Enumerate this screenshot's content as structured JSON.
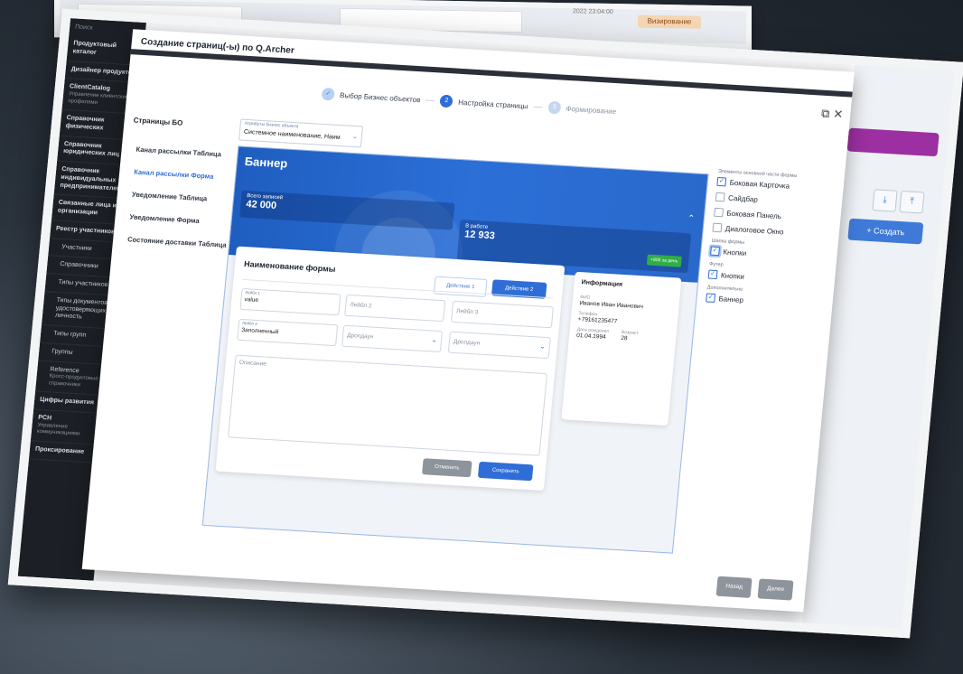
{
  "background": {
    "status_badge": "Визирование",
    "timestamp": "2022 23:04:00"
  },
  "app": {
    "search_placeholder": "Поиск",
    "sidebar": [
      {
        "label": "Продуктовый каталог",
        "sub": false,
        "hint": ""
      },
      {
        "label": "Дизайнер продуктов",
        "sub": false,
        "hint": ""
      },
      {
        "label": "ClientCatalog",
        "sub": false,
        "hint": "Управление клиентскими профилями"
      },
      {
        "label": "Справочник физических",
        "sub": false,
        "hint": ""
      },
      {
        "label": "Справочник юридических лиц",
        "sub": false,
        "hint": ""
      },
      {
        "label": "Справочник индивидуальных предпринимателей",
        "sub": false,
        "hint": ""
      },
      {
        "label": "Связанные лица и организации",
        "sub": false,
        "hint": ""
      },
      {
        "label": "Реестр участников",
        "sub": false,
        "hint": ""
      },
      {
        "label": "Участники",
        "sub": true,
        "hint": ""
      },
      {
        "label": "Справочники",
        "sub": true,
        "hint": ""
      },
      {
        "label": "Типы участников",
        "sub": true,
        "hint": ""
      },
      {
        "label": "Типы документов, удостоверяющих личность",
        "sub": true,
        "hint": ""
      },
      {
        "label": "Типы групп",
        "sub": true,
        "hint": ""
      },
      {
        "label": "Группы",
        "sub": true,
        "hint": ""
      },
      {
        "label": "Reference",
        "sub": true,
        "hint": "Кросс-продуктовые справочники"
      },
      {
        "label": "Цифры развития",
        "sub": false,
        "hint": ""
      },
      {
        "label": "PCH",
        "sub": false,
        "hint": "Управление коммуникациями"
      },
      {
        "label": "Проксирование",
        "sub": false,
        "hint": ""
      }
    ],
    "create_button": "+ Создать"
  },
  "modal": {
    "title": "Создание страниц(-ы) по Q.Archer",
    "steps": [
      {
        "num": "✓",
        "label": "Выбор Бизнес объектов",
        "state": "done"
      },
      {
        "num": "2",
        "label": "Настройка страницы",
        "state": "active"
      },
      {
        "num": "3",
        "label": "Формирование",
        "state": "todo"
      }
    ],
    "pages_title": "Страницы БО",
    "pages": [
      {
        "label": "Канал рассылки Таблица",
        "active": false
      },
      {
        "label": "Канал рассылки Форма",
        "active": true
      },
      {
        "label": "Уведомление Таблица",
        "active": false
      },
      {
        "label": "Уведомление Форма",
        "active": false
      },
      {
        "label": "Состояние доставки Таблица",
        "active": false
      }
    ],
    "attr_select": {
      "label": "Атрибуты бизнес объекта",
      "value": "Системное наименование, Наим"
    },
    "banner": {
      "title": "Баннер",
      "total_label": "Всего записей",
      "total_value": "42 000",
      "inwork_label": "В работе",
      "inwork_value": "12 933",
      "delta": "+800 за день"
    },
    "form": {
      "name": "Наименование формы",
      "action1": "Действие 1",
      "action2": "Действие 2",
      "fields": {
        "f1_label": "Лейбл 1",
        "f1_value": "value",
        "f2_placeholder": "Лейбл 2",
        "f3_placeholder": "Лейбл 3",
        "f4_label": "Лейбл 4",
        "f4_value": "Заполненный",
        "dd1": "Дропдаун",
        "dd2": "Дропдаун",
        "description": "Описание"
      },
      "cancel": "Отменить",
      "save": "Сохранить"
    },
    "info": {
      "title": "Информация",
      "fio_label": "ФИО",
      "fio": "Иванов Иван Иванович",
      "phone_label": "Телефон",
      "phone": "+79161235477",
      "dob_label": "Дата рождения",
      "dob": "01.04.1994",
      "age_label": "Возраст",
      "age": "28"
    },
    "options": {
      "main_group": "Элементы основной части формы",
      "side_card": "Боковая Карточка",
      "sidebar": "Сайдбар",
      "side_panel": "Боковая Панель",
      "dialog": "Диалоговое Окно",
      "header_group": "Шапка формы",
      "header_buttons": "Кнопки",
      "footer_group": "Футер",
      "footer_buttons": "Кнопки",
      "extra_group": "Дополнительно",
      "banner": "Баннер"
    },
    "back": "Назад",
    "next": "Далее"
  }
}
